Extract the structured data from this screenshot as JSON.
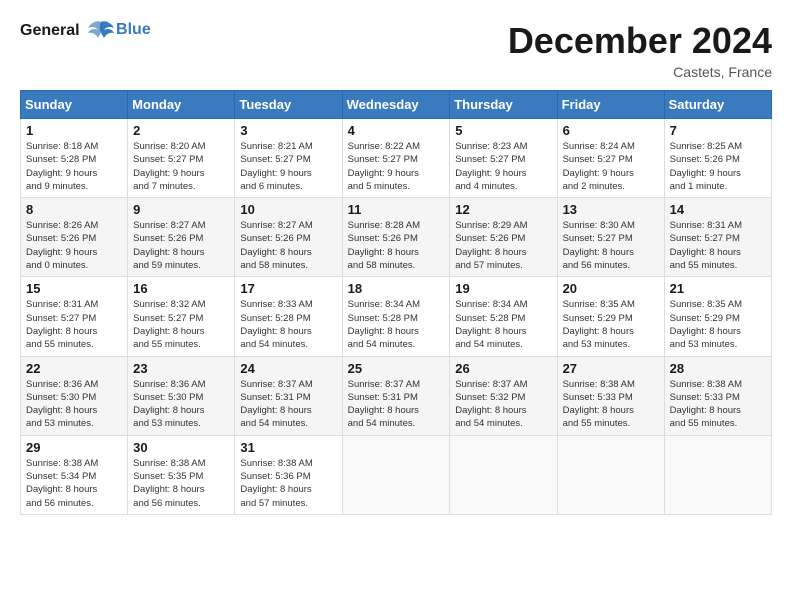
{
  "logo": {
    "line1": "General",
    "line2": "Blue"
  },
  "title": "December 2024",
  "location": "Castets, France",
  "days_header": [
    "Sunday",
    "Monday",
    "Tuesday",
    "Wednesday",
    "Thursday",
    "Friday",
    "Saturday"
  ],
  "weeks": [
    [
      {
        "day": "1",
        "info": "Sunrise: 8:18 AM\nSunset: 5:28 PM\nDaylight: 9 hours\nand 9 minutes."
      },
      {
        "day": "2",
        "info": "Sunrise: 8:20 AM\nSunset: 5:27 PM\nDaylight: 9 hours\nand 7 minutes."
      },
      {
        "day": "3",
        "info": "Sunrise: 8:21 AM\nSunset: 5:27 PM\nDaylight: 9 hours\nand 6 minutes."
      },
      {
        "day": "4",
        "info": "Sunrise: 8:22 AM\nSunset: 5:27 PM\nDaylight: 9 hours\nand 5 minutes."
      },
      {
        "day": "5",
        "info": "Sunrise: 8:23 AM\nSunset: 5:27 PM\nDaylight: 9 hours\nand 4 minutes."
      },
      {
        "day": "6",
        "info": "Sunrise: 8:24 AM\nSunset: 5:27 PM\nDaylight: 9 hours\nand 2 minutes."
      },
      {
        "day": "7",
        "info": "Sunrise: 8:25 AM\nSunset: 5:26 PM\nDaylight: 9 hours\nand 1 minute."
      }
    ],
    [
      {
        "day": "8",
        "info": "Sunrise: 8:26 AM\nSunset: 5:26 PM\nDaylight: 9 hours\nand 0 minutes."
      },
      {
        "day": "9",
        "info": "Sunrise: 8:27 AM\nSunset: 5:26 PM\nDaylight: 8 hours\nand 59 minutes."
      },
      {
        "day": "10",
        "info": "Sunrise: 8:27 AM\nSunset: 5:26 PM\nDaylight: 8 hours\nand 58 minutes."
      },
      {
        "day": "11",
        "info": "Sunrise: 8:28 AM\nSunset: 5:26 PM\nDaylight: 8 hours\nand 58 minutes."
      },
      {
        "day": "12",
        "info": "Sunrise: 8:29 AM\nSunset: 5:26 PM\nDaylight: 8 hours\nand 57 minutes."
      },
      {
        "day": "13",
        "info": "Sunrise: 8:30 AM\nSunset: 5:27 PM\nDaylight: 8 hours\nand 56 minutes."
      },
      {
        "day": "14",
        "info": "Sunrise: 8:31 AM\nSunset: 5:27 PM\nDaylight: 8 hours\nand 55 minutes."
      }
    ],
    [
      {
        "day": "15",
        "info": "Sunrise: 8:31 AM\nSunset: 5:27 PM\nDaylight: 8 hours\nand 55 minutes."
      },
      {
        "day": "16",
        "info": "Sunrise: 8:32 AM\nSunset: 5:27 PM\nDaylight: 8 hours\nand 55 minutes."
      },
      {
        "day": "17",
        "info": "Sunrise: 8:33 AM\nSunset: 5:28 PM\nDaylight: 8 hours\nand 54 minutes."
      },
      {
        "day": "18",
        "info": "Sunrise: 8:34 AM\nSunset: 5:28 PM\nDaylight: 8 hours\nand 54 minutes."
      },
      {
        "day": "19",
        "info": "Sunrise: 8:34 AM\nSunset: 5:28 PM\nDaylight: 8 hours\nand 54 minutes."
      },
      {
        "day": "20",
        "info": "Sunrise: 8:35 AM\nSunset: 5:29 PM\nDaylight: 8 hours\nand 53 minutes."
      },
      {
        "day": "21",
        "info": "Sunrise: 8:35 AM\nSunset: 5:29 PM\nDaylight: 8 hours\nand 53 minutes."
      }
    ],
    [
      {
        "day": "22",
        "info": "Sunrise: 8:36 AM\nSunset: 5:30 PM\nDaylight: 8 hours\nand 53 minutes."
      },
      {
        "day": "23",
        "info": "Sunrise: 8:36 AM\nSunset: 5:30 PM\nDaylight: 8 hours\nand 53 minutes."
      },
      {
        "day": "24",
        "info": "Sunrise: 8:37 AM\nSunset: 5:31 PM\nDaylight: 8 hours\nand 54 minutes."
      },
      {
        "day": "25",
        "info": "Sunrise: 8:37 AM\nSunset: 5:31 PM\nDaylight: 8 hours\nand 54 minutes."
      },
      {
        "day": "26",
        "info": "Sunrise: 8:37 AM\nSunset: 5:32 PM\nDaylight: 8 hours\nand 54 minutes."
      },
      {
        "day": "27",
        "info": "Sunrise: 8:38 AM\nSunset: 5:33 PM\nDaylight: 8 hours\nand 55 minutes."
      },
      {
        "day": "28",
        "info": "Sunrise: 8:38 AM\nSunset: 5:33 PM\nDaylight: 8 hours\nand 55 minutes."
      }
    ],
    [
      {
        "day": "29",
        "info": "Sunrise: 8:38 AM\nSunset: 5:34 PM\nDaylight: 8 hours\nand 56 minutes."
      },
      {
        "day": "30",
        "info": "Sunrise: 8:38 AM\nSunset: 5:35 PM\nDaylight: 8 hours\nand 56 minutes."
      },
      {
        "day": "31",
        "info": "Sunrise: 8:38 AM\nSunset: 5:36 PM\nDaylight: 8 hours\nand 57 minutes."
      },
      {
        "day": "",
        "info": ""
      },
      {
        "day": "",
        "info": ""
      },
      {
        "day": "",
        "info": ""
      },
      {
        "day": "",
        "info": ""
      }
    ]
  ]
}
